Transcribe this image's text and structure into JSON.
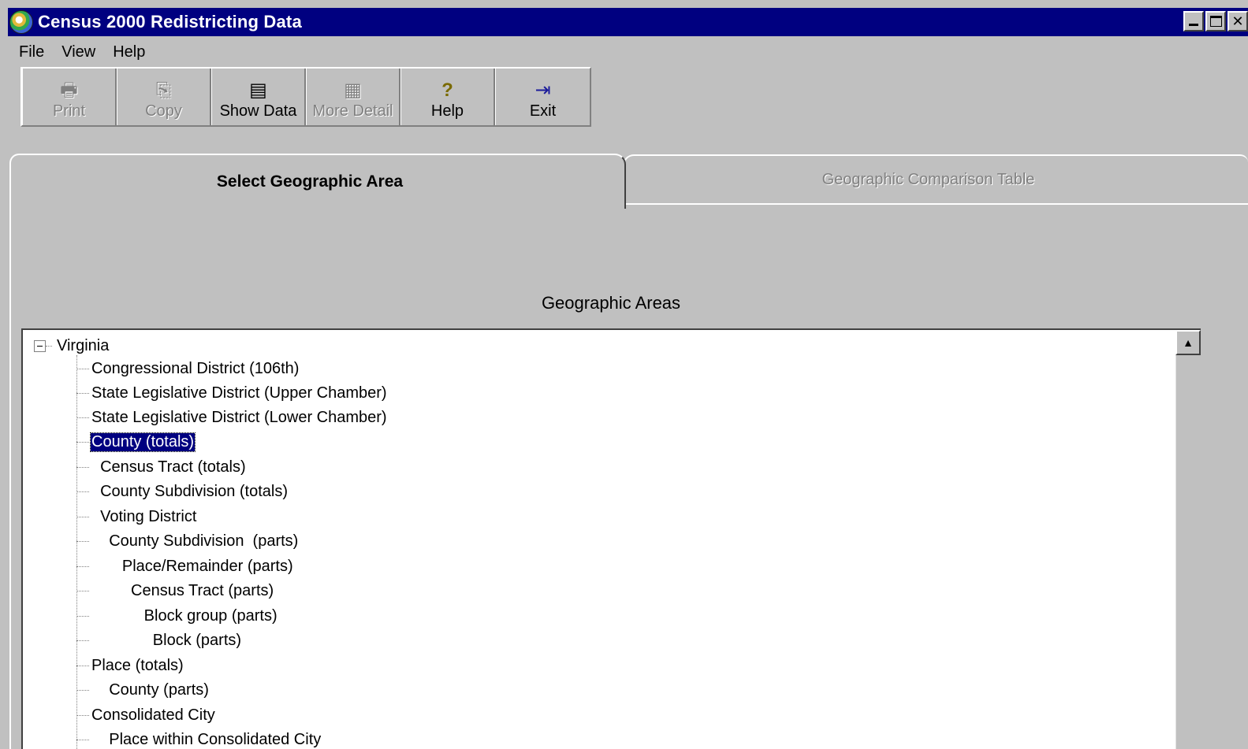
{
  "window": {
    "title": "Census 2000 Redistricting Data",
    "icon": "census-cd-icon",
    "controls": [
      "minimize",
      "maximize",
      "close"
    ],
    "close_glyph": "✕"
  },
  "menu": [
    {
      "label": "File"
    },
    {
      "label": "View"
    },
    {
      "label": "Help"
    }
  ],
  "toolbar": [
    {
      "label": "Print",
      "icon": "printer-icon",
      "glyph": "🖶",
      "enabled": false
    },
    {
      "label": "Copy",
      "icon": "copy-icon",
      "glyph": "⎘",
      "enabled": false
    },
    {
      "label": "Show Data",
      "icon": "document-icon",
      "glyph": "▤",
      "enabled": true
    },
    {
      "label": "More Detail",
      "icon": "building-icon",
      "glyph": "▦",
      "enabled": false
    },
    {
      "label": "Help",
      "icon": "question-icon",
      "glyph": "?",
      "enabled": true
    },
    {
      "label": "Exit",
      "icon": "exit-door-icon",
      "glyph": "⇥",
      "enabled": true
    }
  ],
  "tabs": [
    {
      "label": "Select Geographic Area",
      "active": true
    },
    {
      "label": "Geographic Comparison Table",
      "active": false
    }
  ],
  "section_heading": "Geographic Areas",
  "tree": {
    "root": "Virginia",
    "expander": "minus",
    "items": [
      {
        "label": "Congressional District (106th)",
        "selected": false
      },
      {
        "label": "State Legislative District (Upper Chamber)",
        "selected": false
      },
      {
        "label": "State Legislative District (Lower Chamber)",
        "selected": false
      },
      {
        "label": "County (totals)",
        "selected": true
      },
      {
        "label": "  Census Tract (totals)",
        "selected": false
      },
      {
        "label": "  County Subdivision (totals)",
        "selected": false
      },
      {
        "label": "  Voting District",
        "selected": false
      },
      {
        "label": "    County Subdivision  (parts)",
        "selected": false
      },
      {
        "label": "       Place/Remainder (parts)",
        "selected": false
      },
      {
        "label": "         Census Tract (parts)",
        "selected": false
      },
      {
        "label": "            Block group (parts)",
        "selected": false
      },
      {
        "label": "              Block (parts)",
        "selected": false
      },
      {
        "label": "Place (totals)",
        "selected": false
      },
      {
        "label": "    County (parts)",
        "selected": false
      },
      {
        "label": "Consolidated City",
        "selected": false
      },
      {
        "label": "    Place within Consolidated City",
        "selected": false
      }
    ]
  },
  "scrollbar": {
    "up_arrow": "▲"
  }
}
